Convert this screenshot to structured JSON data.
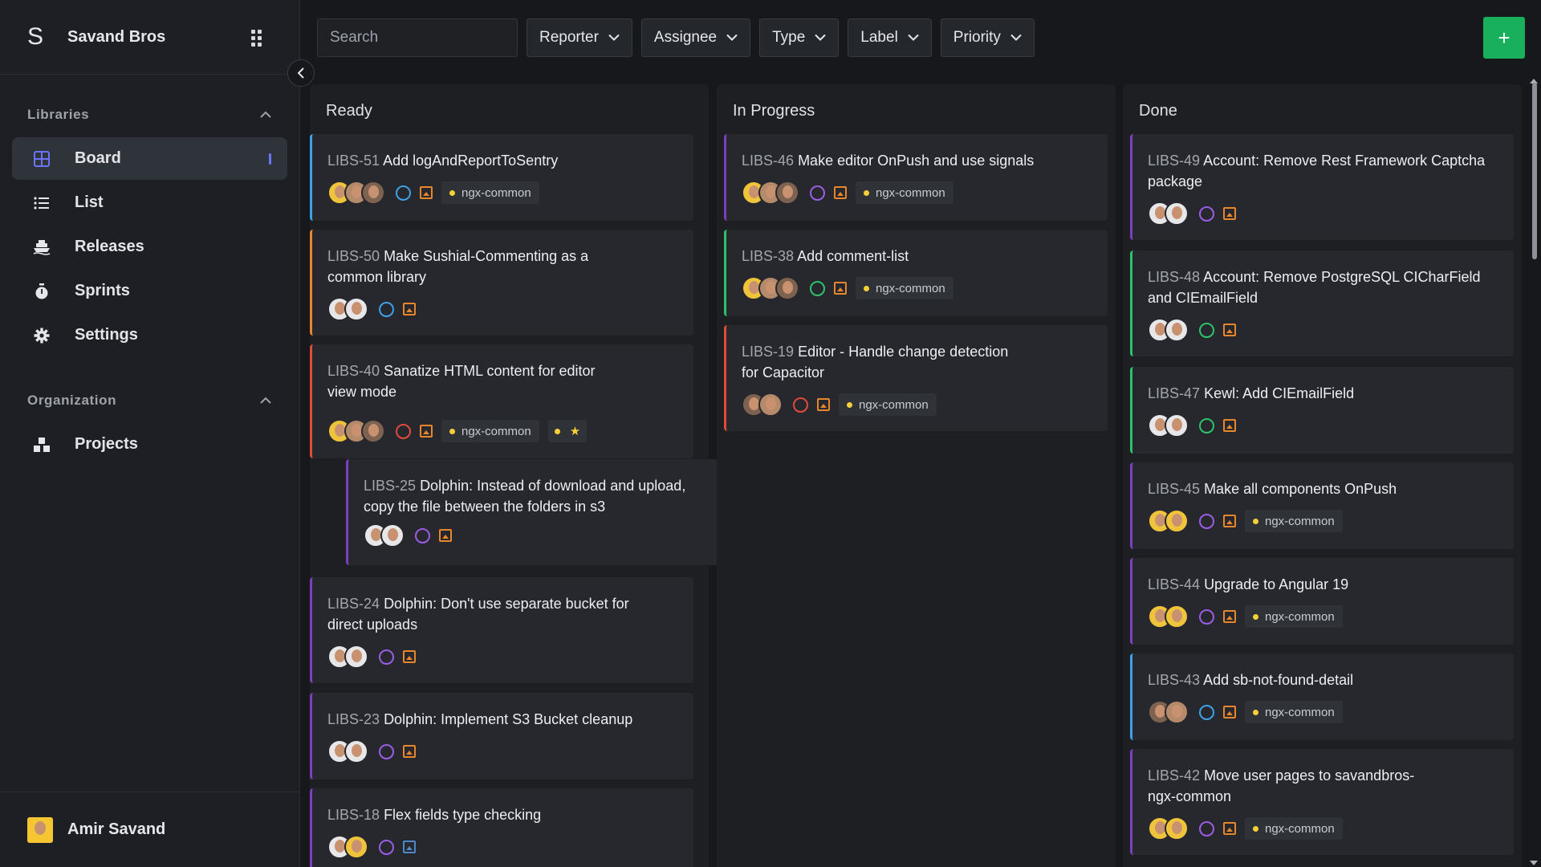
{
  "brand": {
    "logo": "S",
    "name": "Savand Bros"
  },
  "sidebar": {
    "sections": [
      {
        "title": "Libraries",
        "items": [
          {
            "label": "Board",
            "icon": "board-icon",
            "active": true
          },
          {
            "label": "List",
            "icon": "list-icon"
          },
          {
            "label": "Releases",
            "icon": "ship-icon"
          },
          {
            "label": "Sprints",
            "icon": "stopwatch-icon"
          },
          {
            "label": "Settings",
            "icon": "gear-icon"
          }
        ]
      },
      {
        "title": "Organization",
        "items": [
          {
            "label": "Projects",
            "icon": "cubes-icon"
          }
        ]
      }
    ],
    "user": {
      "name": "Amir Savand"
    }
  },
  "toolbar": {
    "search_placeholder": "Search",
    "filters": [
      "Reporter",
      "Assignee",
      "Type",
      "Label",
      "Priority"
    ],
    "add_label": "+"
  },
  "columns": [
    {
      "title": "Ready",
      "cards": [
        {
          "key": "LIBS-51",
          "title": "Add logAndReportToSentry"
        },
        {
          "key": "LIBS-50",
          "title": "Make Sushial-Commenting as a common library"
        },
        {
          "key": "LIBS-40",
          "title": "Sanatize HTML content for editor view mode"
        },
        {
          "key": "LIBS-25",
          "title": "Dolphin: Instead of download and upload, copy the file between the folders in s3"
        },
        {
          "key": "LIBS-24",
          "title": "Dolphin: Don't use separate bucket for direct uploads"
        },
        {
          "key": "LIBS-23",
          "title": "Dolphin: Implement S3 Bucket cleanup"
        },
        {
          "key": "LIBS-18",
          "title": "Flex fields type checking"
        }
      ]
    },
    {
      "title": "In Progress",
      "cards": [
        {
          "key": "LIBS-46",
          "title": "Make editor OnPush and use signals"
        },
        {
          "key": "LIBS-38",
          "title": "Add comment-list"
        },
        {
          "key": "LIBS-19",
          "title": "Editor - Handle change detection for Capacitor"
        }
      ]
    },
    {
      "title": "Done",
      "cards": [
        {
          "key": "LIBS-49",
          "title": "Account: Remove Rest Framework Captcha package"
        },
        {
          "key": "LIBS-48",
          "title": "Account: Remove PostgreSQL CICharField and CIEmailField"
        },
        {
          "key": "LIBS-47",
          "title": "Kewl: Add CIEmailField"
        },
        {
          "key": "LIBS-45",
          "title": "Make all components OnPush"
        },
        {
          "key": "LIBS-44",
          "title": "Upgrade to Angular 19"
        },
        {
          "key": "LIBS-43",
          "title": "Add sb-not-found-detail"
        },
        {
          "key": "LIBS-42",
          "title": "Move user pages to savandbros-ngx-common"
        }
      ]
    }
  ],
  "label_text": "ngx-common",
  "colors": {
    "accent": "#6c74ff",
    "add": "#18b05c",
    "bug": "#e24b3b",
    "feature": "#7b3fbf",
    "task": "#3ea2e8",
    "story": "#2ec36b"
  }
}
